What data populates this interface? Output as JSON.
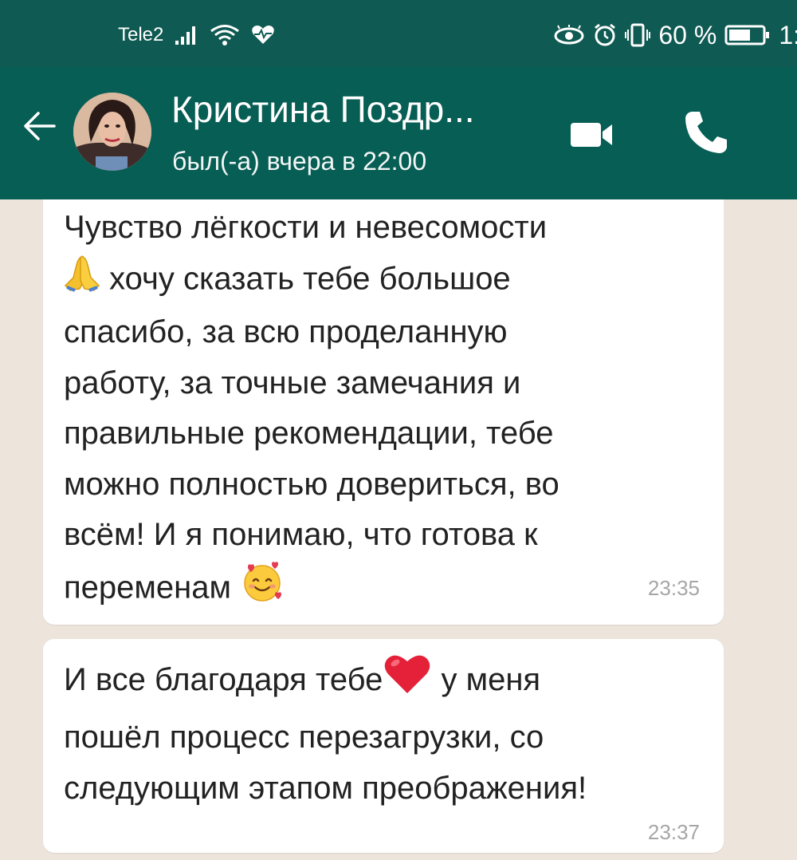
{
  "status_bar": {
    "carrier": "Tele2",
    "battery_percent": "60 %",
    "clock": "1:",
    "icons": [
      "signal-icon",
      "wifi-icon",
      "health-icon",
      "eye-icon",
      "alarm-icon",
      "vibrate-icon",
      "battery-icon"
    ]
  },
  "header": {
    "contact_name": "Кристина Поздр...",
    "last_seen": "был(-а) вчера в 22:00",
    "icons": [
      "back-arrow-icon",
      "video-call-icon",
      "phone-call-icon"
    ]
  },
  "messages": [
    {
      "lines": [
        "Чувство лёгкости и невесомости",
        "хочу сказать тебе большое",
        "спасибо, за всю проделанную",
        "работу, за точные замечания и",
        "правильные рекомендации, тебе",
        "можно полностью довериться, во",
        "всём! И я понимаю, что готова к",
        "переменам"
      ],
      "emojis": [
        "folded-hands-emoji",
        "smiling-face-with-hearts-emoji"
      ],
      "time": "23:35"
    },
    {
      "lines": [
        "И все благодаря тебе",
        "у меня",
        "пошёл процесс перезагрузки, со",
        "следующим этапом преображения!"
      ],
      "emojis": [
        "red-heart-emoji"
      ],
      "time": "23:37"
    }
  ],
  "colors": {
    "status_bar": "#0f5a52",
    "header": "#075e54",
    "chat_background": "#ede5dc",
    "bubble": "#ffffff",
    "time_text": "#a6a6a6"
  }
}
